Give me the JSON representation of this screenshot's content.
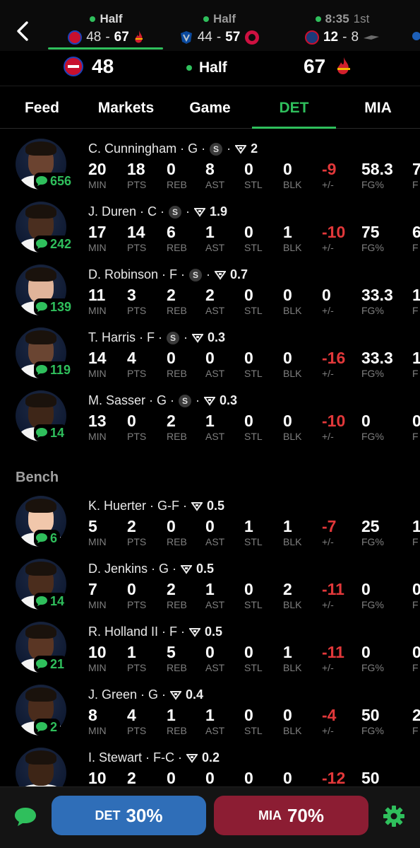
{
  "colors": {
    "accent": "#2fbf5c",
    "negative": "#e2383a",
    "det_button": "#2f6eb8",
    "mia_button": "#8c1d33"
  },
  "games": [
    {
      "status": "Half",
      "period": "",
      "away_logo": "pistons-logo",
      "away_score": "48",
      "home_score": "67",
      "home_logo": "heat-logo",
      "active": true
    },
    {
      "status": "Half",
      "period": "",
      "away_logo": "mavericks-logo",
      "away_score": "44",
      "home_score": "57",
      "home_logo": "raptors-logo",
      "active": false
    },
    {
      "status": "8:35",
      "period": "1st",
      "away_logo": "wizards-logo",
      "away_score": "12",
      "home_score": "8",
      "home_logo": "pelicans-logo",
      "active": false
    }
  ],
  "scoreboard": {
    "home_score": "48",
    "status": "Half",
    "away_score": "67"
  },
  "tabs": [
    "Feed",
    "Markets",
    "Game",
    "DET",
    "MIA"
  ],
  "stat_labels": [
    "MIN",
    "PTS",
    "REB",
    "AST",
    "STL",
    "BLK",
    "+/-",
    "FG%"
  ],
  "bench_label": "Bench",
  "starters": [
    {
      "name": "C. Cunningham · G ·",
      "starter": true,
      "rating": "2",
      "comments": "656",
      "stats": [
        "20",
        "18",
        "0",
        "8",
        "0",
        "0",
        "-9",
        "58.3"
      ],
      "extra": "7"
    },
    {
      "name": "J. Duren · C ·",
      "starter": true,
      "rating": "1.9",
      "comments": "242",
      "stats": [
        "17",
        "14",
        "6",
        "1",
        "0",
        "1",
        "-10",
        "75"
      ],
      "extra": "6"
    },
    {
      "name": "D. Robinson · F ·",
      "starter": true,
      "rating": "0.7",
      "comments": "139",
      "stats": [
        "11",
        "3",
        "2",
        "2",
        "0",
        "0",
        "0",
        "33.3"
      ],
      "extra": "1"
    },
    {
      "name": "T. Harris · F ·",
      "starter": true,
      "rating": "0.3",
      "comments": "119",
      "stats": [
        "14",
        "4",
        "0",
        "0",
        "0",
        "0",
        "-16",
        "33.3"
      ],
      "extra": "1"
    },
    {
      "name": "M. Sasser · G ·",
      "starter": true,
      "rating": "0.3",
      "comments": "14",
      "stats": [
        "13",
        "0",
        "2",
        "1",
        "0",
        "0",
        "-10",
        "0"
      ],
      "extra": "0"
    }
  ],
  "bench": [
    {
      "name": "K. Huerter · G-F ·",
      "starter": false,
      "rating": "0.5",
      "comments": "6",
      "stats": [
        "5",
        "2",
        "0",
        "0",
        "1",
        "1",
        "-7",
        "25"
      ],
      "extra": "1"
    },
    {
      "name": "D. Jenkins · G ·",
      "starter": false,
      "rating": "0.5",
      "comments": "14",
      "stats": [
        "7",
        "0",
        "2",
        "1",
        "0",
        "2",
        "-11",
        "0"
      ],
      "extra": "0"
    },
    {
      "name": "R. Holland II · F ·",
      "starter": false,
      "rating": "0.5",
      "comments": "21",
      "stats": [
        "10",
        "1",
        "5",
        "0",
        "0",
        "1",
        "-11",
        "0"
      ],
      "extra": "0"
    },
    {
      "name": "J. Green · G ·",
      "starter": false,
      "rating": "0.4",
      "comments": "2",
      "stats": [
        "8",
        "4",
        "1",
        "1",
        "0",
        "0",
        "-4",
        "50"
      ],
      "extra": "2"
    },
    {
      "name": "I. Stewart · F-C ·",
      "starter": false,
      "rating": "0.2",
      "comments": "",
      "stats": [
        "10",
        "2",
        "0",
        "0",
        "0",
        "0",
        "-12",
        "50"
      ],
      "extra": ""
    }
  ],
  "bottom": {
    "det_team": "DET",
    "det_pct": "30%",
    "mia_team": "MIA",
    "mia_pct": "70%"
  }
}
